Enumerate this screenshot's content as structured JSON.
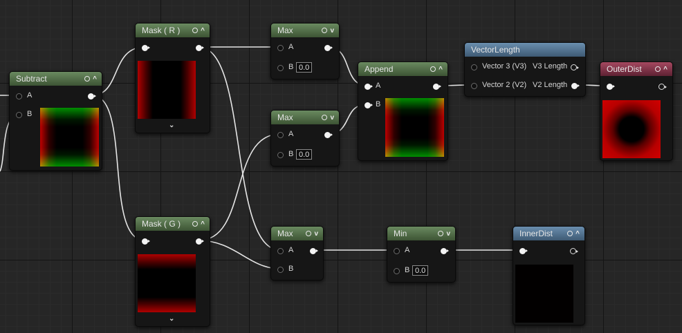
{
  "graph": {
    "nodes": {
      "subtract": {
        "title": "Subtract",
        "in_a": "A",
        "in_b": "B"
      },
      "mask_r": {
        "title": "Mask ( R )"
      },
      "mask_g": {
        "title": "Mask ( G )"
      },
      "max1": {
        "title": "Max",
        "in_a": "A",
        "in_b": "B",
        "b_value": "0.0"
      },
      "max2": {
        "title": "Max",
        "in_a": "A",
        "in_b": "B",
        "b_value": "0.0"
      },
      "max3": {
        "title": "Max",
        "in_a": "A",
        "in_b": "B"
      },
      "append": {
        "title": "Append",
        "in_a": "A",
        "in_b": "B"
      },
      "vector_length": {
        "title": "VectorLength",
        "in_v3": "Vector 3 (V3)",
        "in_v2": "Vector 2 (V2)",
        "out_v3": "V3 Length",
        "out_v2": "V2 Length"
      },
      "outer_dist": {
        "title": "OuterDist"
      },
      "min": {
        "title": "Min",
        "in_a": "A",
        "in_b": "B",
        "b_value": "0.0"
      },
      "inner_dist": {
        "title": "InnerDist"
      }
    }
  },
  "colors": {
    "header_green": "#4f6b45",
    "header_blue": "#4f7090",
    "header_red": "#7a2d42",
    "wire": "#e8e8e8"
  },
  "icons": [
    "preview-toggle-icon",
    "collapse-chevron-icon",
    "expand-chevron-icon"
  ]
}
